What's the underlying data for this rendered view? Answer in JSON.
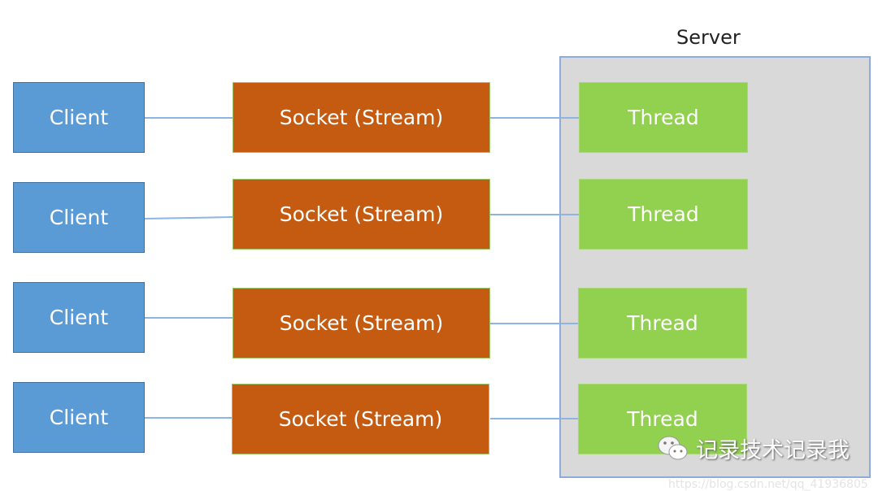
{
  "server": {
    "label": "Server"
  },
  "rows": [
    {
      "client": "Client",
      "socket": "Socket (Stream)",
      "thread": "Thread"
    },
    {
      "client": "Client",
      "socket": "Socket (Stream)",
      "thread": "Thread"
    },
    {
      "client": "Client",
      "socket": "Socket (Stream)",
      "thread": "Thread"
    },
    {
      "client": "Client",
      "socket": "Socket (Stream)",
      "thread": "Thread"
    }
  ],
  "watermark": {
    "icon": "wechat-icon",
    "text": "记录技术记录我",
    "url": "https://blog.csdn.net/qq_41936805"
  },
  "colors": {
    "client": "#5b9bd5",
    "socket": "#c55a11",
    "thread": "#92d050",
    "server": "#d9d9d9",
    "connector": "#8db4e2"
  }
}
